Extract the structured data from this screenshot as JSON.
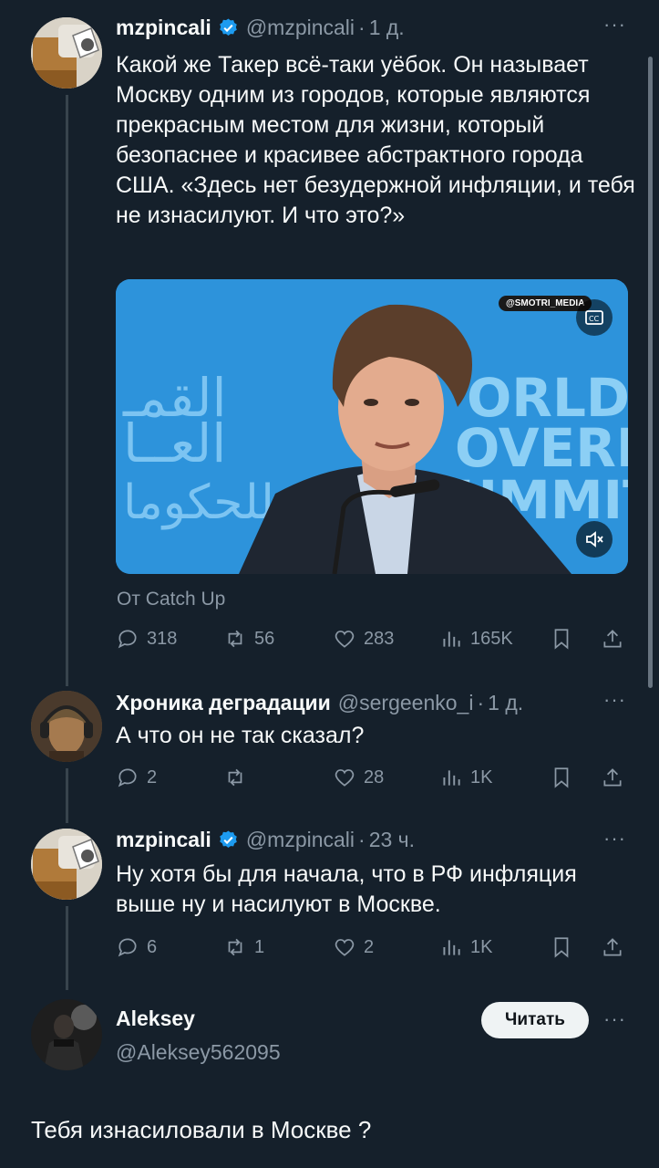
{
  "tweets": [
    {
      "name": "mzpincali",
      "handle": "@mzpincali",
      "time": "1 д.",
      "text": "Какой же Такер всё-таки уёбок. Он называет Москву одним из городов, которые являются прекрасным местом для жизни, который безопаснее и красивее абстрактного города  США. «Здесь нет безудержной инфляции, и тебя не изнасилуют. И что это?»",
      "source": "От Catch Up",
      "stats": {
        "replies": "318",
        "retweets": "56",
        "likes": "283",
        "views": "165K"
      }
    },
    {
      "name": "Хроника деградации",
      "handle": "@sergeenko_i",
      "time": "1 д.",
      "text": "А что он не так сказал?",
      "stats": {
        "replies": "2",
        "retweets": "",
        "likes": "28",
        "views": "1K"
      }
    },
    {
      "name": "mzpincali",
      "handle": "@mzpincali",
      "time": "23 ч.",
      "text": "Ну хотя бы для начала, что в РФ инфляция выше ну и насилуют в Москве.",
      "stats": {
        "replies": "6",
        "retweets": "1",
        "likes": "2",
        "views": "1K"
      }
    }
  ],
  "media": {
    "watermark": "@SMOTRI_MEDIA",
    "bg_text_right": "ORLD OVERN UMMIT",
    "bg_text_left": "القمة العالمية للحكومات"
  },
  "main": {
    "name": "Aleksey",
    "handle": "@Aleksey562095",
    "follow_label": "Читать",
    "text": "Тебя изнасиловали в Москве ?"
  },
  "colors": {
    "bg": "#15202b",
    "muted": "#8b98a5",
    "verified": "#1d9bf0"
  }
}
